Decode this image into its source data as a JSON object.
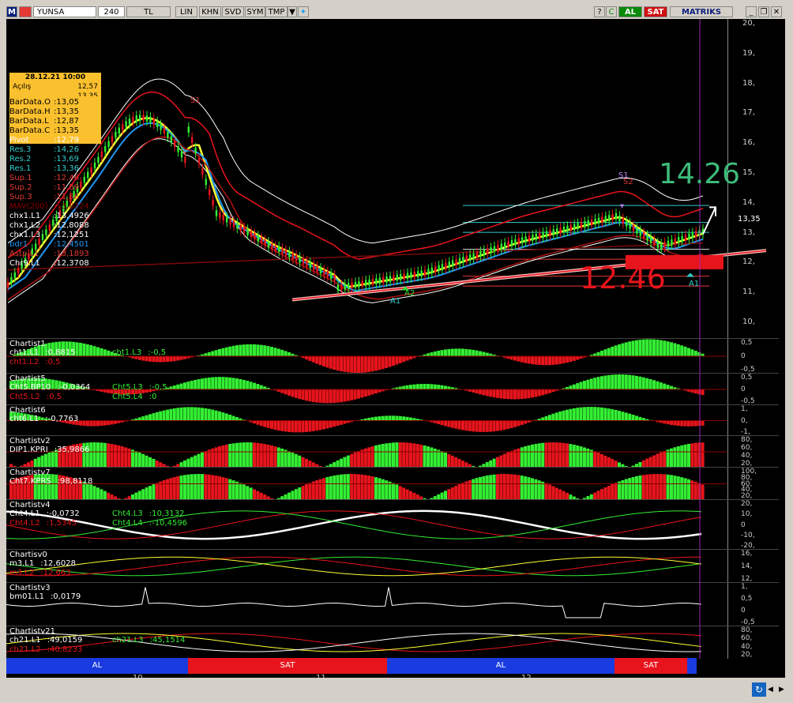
{
  "toolbar": {
    "symbol": "YUNSA",
    "period": "240",
    "currency": "TL",
    "scale": "LIN",
    "buttons": [
      "KHN",
      "SVD",
      "SYM",
      "TMP"
    ],
    "buy_label": "AL",
    "sell_label": "SAT",
    "brand": "MATRIKS",
    "icons": [
      "m-logo-icon",
      "flag-tr-icon",
      "dropdown-icon",
      "twitter-icon",
      "help-icon",
      "refresh-icon",
      "minimize-icon",
      "restore-icon",
      "close-icon"
    ]
  },
  "price_axis": [
    "20,",
    "19,",
    "18,",
    "17,",
    "16,",
    "15,",
    "14,",
    "13,",
    "12,",
    "11,",
    "10,"
  ],
  "price_current": "13,35",
  "tooltip": {
    "date": "28.12.21 10:00",
    "open_label": "Açılış",
    "open_value": "12,57",
    "cut_value": "13,35"
  },
  "data_rows": [
    {
      "label": "BarData.O",
      "value": ":13,05",
      "color": "#000000"
    },
    {
      "label": "BarData.H",
      "value": ":13,35",
      "color": "#000000"
    },
    {
      "label": "BarData.L",
      "value": ":12,87",
      "color": "#000000"
    },
    {
      "label": "BarData.C",
      "value": ":13,35",
      "color": "#000000"
    },
    {
      "label": "Pivot",
      "value": ":12,79",
      "color": "#ffffff"
    },
    {
      "label": "Res.3",
      "value": ":14,26",
      "color": "#33cccc"
    },
    {
      "label": "Res.2",
      "value": ":13,69",
      "color": "#33cccc"
    },
    {
      "label": "Res.1",
      "value": ":13,36",
      "color": "#33cccc"
    },
    {
      "label": "Sup.1",
      "value": ":12,46",
      "color": "#e53935"
    },
    {
      "label": "Sup.2",
      "value": ":11,89",
      "color": "#e53935"
    },
    {
      "label": "Sup.3",
      "value": ":11,56",
      "color": "#e53935"
    },
    {
      "label": "MAV(200)",
      "value": ":13,8224",
      "color": "#8b0000"
    },
    {
      "label": "chx1.L1",
      "value": ":13,4926",
      "color": "#ffffff"
    },
    {
      "label": "chx1.L2",
      "value": ":12,8088",
      "color": "#ffffff"
    },
    {
      "label": "chx1.L3",
      "value": ":12,1251",
      "color": "#ffffff"
    },
    {
      "label": "bdr1",
      "value": ":12,4501",
      "color": "#2196f3"
    },
    {
      "label": "Astp.L1",
      "value": ":13,1893",
      "color": "#e53935"
    },
    {
      "label": "Chr9.L1",
      "value": ":12,3708",
      "color": "#ffffff"
    }
  ],
  "annotations": {
    "big_resistance": "14.26",
    "big_support": "12.46",
    "s1": "S1",
    "s2": "S2",
    "a1_left": "A1",
    "a2": "A2",
    "a1_right": "A1",
    "s_top": "S1"
  },
  "panes": [
    {
      "name": "cht1",
      "title": "Chartist1",
      "labels": [
        [
          "cht1.L1",
          ":0,8815"
        ],
        [
          "cht1.L2",
          ":0,5"
        ],
        [
          "cht1.L3",
          ":-0,5"
        ]
      ],
      "axis": [
        "0,5",
        "0",
        "-0,5"
      ]
    },
    {
      "name": "cht5",
      "title": "Chartist5",
      "labels": [
        [
          "Cht5.BP10",
          ":-0,0364"
        ],
        [
          "Cht5.L2",
          ":0,5"
        ],
        [
          "Cht5.L3",
          ":-0,5"
        ],
        [
          "Cht5.L4",
          ":0"
        ]
      ],
      "axis": [
        "0,5",
        "0",
        "-0,5"
      ]
    },
    {
      "name": "cht6",
      "title": "Chartist6",
      "labels": [
        [
          "cht6.L1",
          ":-0,7763"
        ]
      ],
      "axis": [
        "1,",
        "0,",
        "-1,"
      ]
    },
    {
      "name": "dip",
      "title": "Chartistv2",
      "labels": [
        [
          "DIP1.KPRI",
          ":35,9866"
        ]
      ],
      "axis": [
        "80,",
        "60,",
        "40,",
        "20,"
      ]
    },
    {
      "name": "cht7",
      "title": "Chartistv7",
      "labels": [
        [
          "Cht7.KPRS",
          ":98,8118"
        ]
      ],
      "axis": [
        "100,",
        "80,",
        "60,",
        "40,",
        "20,"
      ]
    },
    {
      "name": "cht4",
      "title": "Chartistv4",
      "labels": [
        [
          "Cht4.L1",
          ":-0,0732"
        ],
        [
          "Cht4.L2",
          ":1,5345"
        ],
        [
          "Cht4.L3",
          ":10,3132"
        ],
        [
          "Cht4.L4",
          ":-10,4596"
        ]
      ],
      "axis": [
        "20,",
        "10,",
        "0",
        "-10,",
        "-20,"
      ]
    },
    {
      "name": "m3",
      "title": "Chartisv0",
      "labels": [
        [
          "m3.L1",
          ":12,6028"
        ],
        [
          "m3.L2",
          ":12,663"
        ]
      ],
      "axis": [
        "16,",
        "14,",
        "12,"
      ]
    },
    {
      "name": "bm01",
      "title": "Chartistv3",
      "labels": [
        [
          "bm01.L1",
          ":0,0179"
        ]
      ],
      "axis": [
        "1,",
        "0,5",
        "0",
        "-0,5"
      ]
    },
    {
      "name": "ch21",
      "title": "Chartistv21",
      "labels": [
        [
          "ch21.L1",
          ":49,0159"
        ],
        [
          "ch21.L2",
          ":40,8233"
        ],
        [
          "ch21.L3",
          ":45,1514"
        ]
      ],
      "axis": [
        "80,",
        "60,",
        "40,",
        "20,"
      ]
    }
  ],
  "signal_bar": [
    {
      "label": "AL",
      "color": "#1a3be0"
    },
    {
      "label": "SAT",
      "color": "#e8141c"
    },
    {
      "label": "AL",
      "color": "#1a3be0"
    },
    {
      "label": "SAT",
      "color": "#e8141c"
    }
  ],
  "date_axis": [
    "10",
    "11",
    "12"
  ],
  "colors": {
    "buy": "#1a3be0",
    "sell": "#e8141c",
    "green_bar": "#33ee33",
    "red_bar": "#e8141c",
    "resistance_text": "#3dbb7a",
    "support_text": "#e8141c"
  }
}
